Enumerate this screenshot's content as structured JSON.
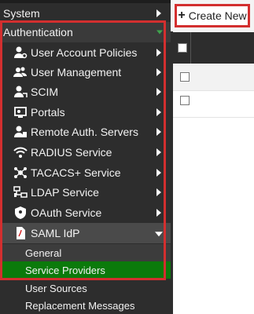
{
  "sidebar": {
    "system": "System",
    "authentication": "Authentication",
    "items": [
      {
        "label": "User Account Policies",
        "icon": "user-gear-icon"
      },
      {
        "label": "User Management",
        "icon": "users-icon"
      },
      {
        "label": "SCIM",
        "icon": "user-sync-icon"
      },
      {
        "label": "Portals",
        "icon": "portal-icon"
      },
      {
        "label": "Remote Auth. Servers",
        "icon": "remote-server-icon"
      },
      {
        "label": "RADIUS Service",
        "icon": "wifi-icon"
      },
      {
        "label": "TACACS+ Service",
        "icon": "network-icon"
      },
      {
        "label": "LDAP Service",
        "icon": "hierarchy-icon"
      },
      {
        "label": "OAuth Service",
        "icon": "shield-icon"
      }
    ],
    "saml": {
      "label": "SAML IdP",
      "icon": "pdf-file-icon"
    },
    "saml_children": [
      "General",
      "Service Providers",
      "User Sources",
      "Replacement Messages"
    ]
  },
  "toolbar": {
    "create_label": "Create New",
    "create_icon": "plus-icon"
  },
  "colors": {
    "sidebar_bg": "#2d2d2d",
    "active_bg": "#0b7a0b",
    "highlight": "#d32f2f"
  }
}
